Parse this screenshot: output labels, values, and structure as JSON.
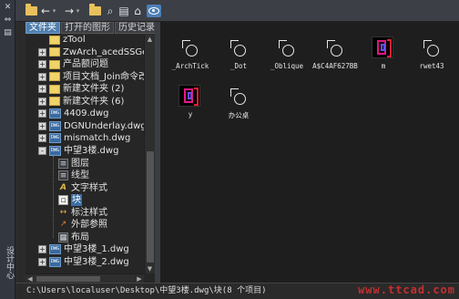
{
  "side_strip": {
    "vertical_label": "设计中心"
  },
  "toolbar": {
    "buttons": [
      {
        "name": "load-folder-icon"
      },
      {
        "name": "back-arrow-icon",
        "glyph": "←"
      },
      {
        "name": "back-dropdown-icon",
        "glyph": "▾"
      },
      {
        "name": "forward-arrow-icon",
        "glyph": "→"
      },
      {
        "name": "forward-dropdown-icon",
        "glyph": "▾"
      },
      {
        "name": "up-folder-icon"
      },
      {
        "name": "search-icon",
        "glyph": "⌕"
      },
      {
        "name": "favorites-icon",
        "glyph": "▤"
      },
      {
        "name": "home-icon",
        "glyph": "⌂"
      },
      {
        "name": "preview-toggle-icon"
      }
    ]
  },
  "tabs": {
    "folders": "文件夹",
    "open_drawings": "打开的图形",
    "history": "历史记录"
  },
  "tree": {
    "items": [
      {
        "label": "zTool",
        "type": "folder",
        "expander": ""
      },
      {
        "label": "ZwArch_acedSSGet_F",
        "type": "folder",
        "expander": "+"
      },
      {
        "label": "产品额问题",
        "type": "folder",
        "expander": "+"
      },
      {
        "label": "项目文档_Join命令改造",
        "type": "folder",
        "expander": "+"
      },
      {
        "label": "新建文件夹 (2)",
        "type": "folder",
        "expander": "+"
      },
      {
        "label": "新建文件夹 (6)",
        "type": "folder",
        "expander": "+"
      },
      {
        "label": "4409.dwg",
        "type": "dwg",
        "expander": "+"
      },
      {
        "label": "DGNUnderlay.dwg",
        "type": "dwg",
        "expander": "+"
      },
      {
        "label": "mismatch.dwg",
        "type": "dwg",
        "expander": "+"
      },
      {
        "label": "中望3楼.dwg",
        "type": "dwg",
        "expander": "-"
      },
      {
        "label": "图层",
        "type": "layer"
      },
      {
        "label": "线型",
        "type": "linetype"
      },
      {
        "label": "文字样式",
        "type": "textstyle"
      },
      {
        "label": "块",
        "type": "block",
        "selected": true
      },
      {
        "label": "标注样式",
        "type": "dimstyle"
      },
      {
        "label": "外部参照",
        "type": "xref"
      },
      {
        "label": "布局",
        "type": "layout"
      },
      {
        "label": "中望3楼_1.dwg",
        "type": "dwg",
        "expander": "+"
      },
      {
        "label": "中望3楼_2.dwg",
        "type": "dwg",
        "expander": "+"
      }
    ]
  },
  "content": {
    "items": [
      {
        "name": "_ArchTick",
        "kind": "block-glyph"
      },
      {
        "name": "_Dot",
        "kind": "block-glyph"
      },
      {
        "name": "_Oblique",
        "kind": "block-glyph"
      },
      {
        "name": "A$C4AF627BB",
        "kind": "block-glyph"
      },
      {
        "name": "m",
        "kind": "thumbnail"
      },
      {
        "name": "rwet43",
        "kind": "block-glyph"
      },
      {
        "name": "y",
        "kind": "thumbnail"
      },
      {
        "name": "办公桌",
        "kind": "block-glyph"
      }
    ]
  },
  "status_bar": {
    "path": "C:\\Users\\localuser\\Desktop\\中望3楼.dwg\\块(8 个项目)"
  },
  "watermark": "www.ttcad.com",
  "colors": {
    "tab_active": "#4f7fae",
    "selection": "#3b6ea5",
    "folder": "#f0d46a",
    "thumbnail_magenta": "#e0187e",
    "thumbnail_violet": "#6b4cf0",
    "watermark": "#e03030"
  }
}
